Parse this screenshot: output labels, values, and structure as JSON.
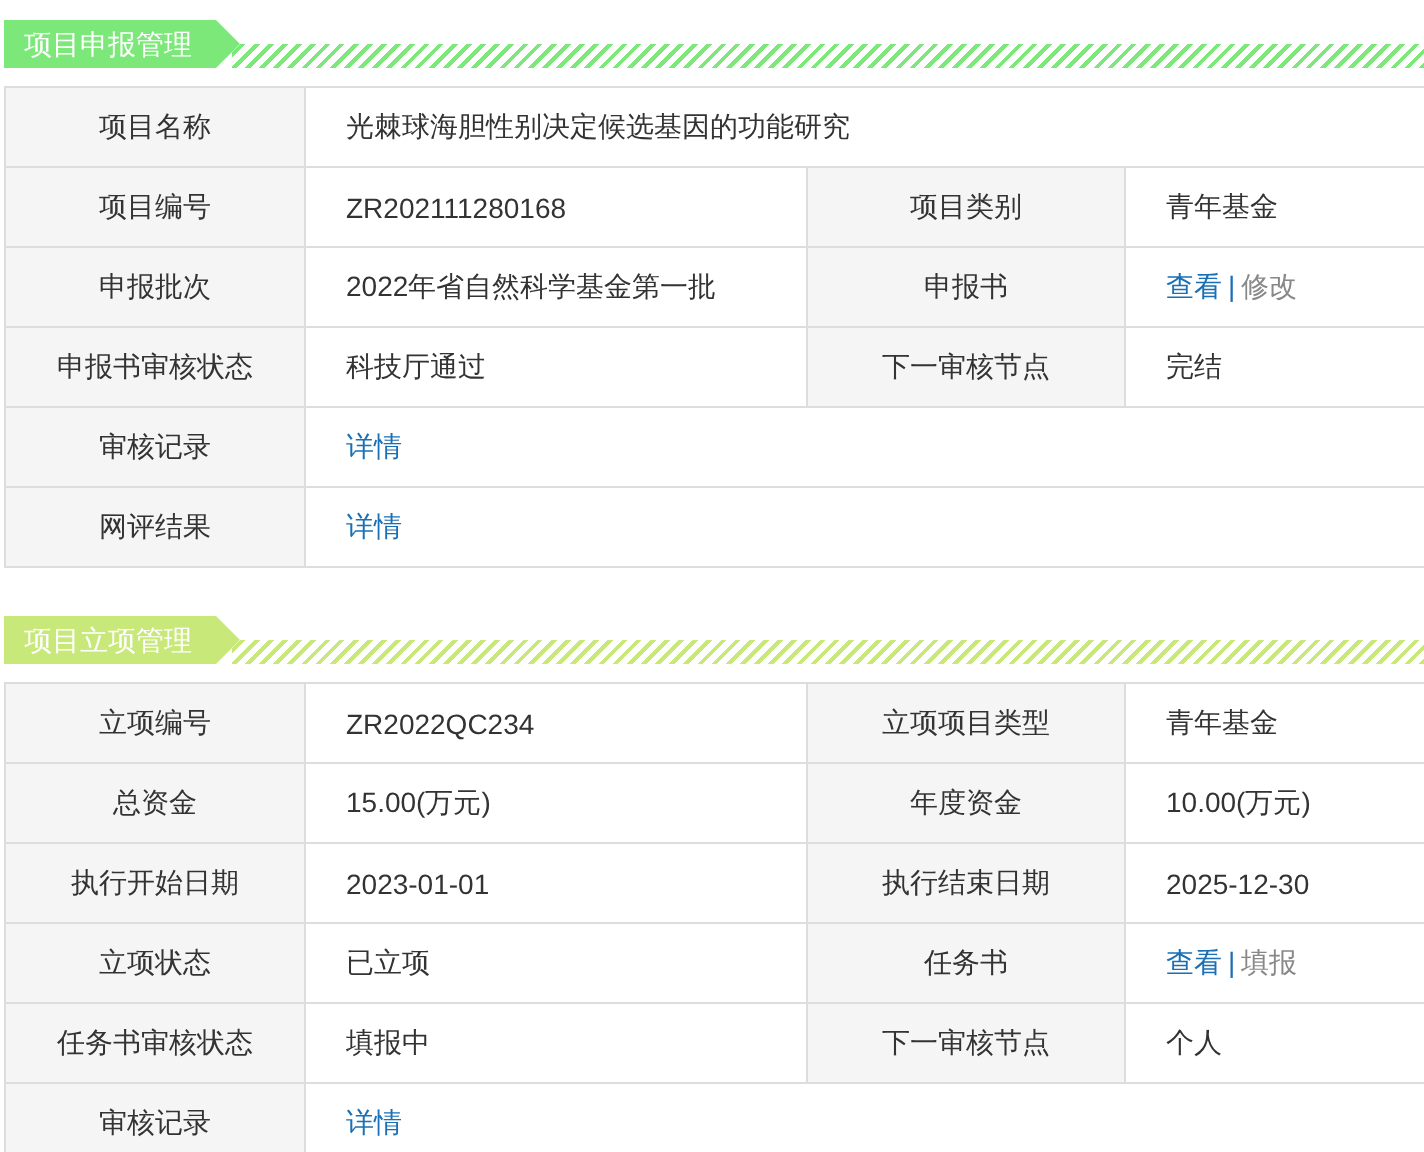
{
  "sections": [
    {
      "title": "项目申报管理",
      "color": "#7de87a",
      "rows": [
        {
          "cells": [
            {
              "kind": "label",
              "text": "项目名称"
            },
            {
              "kind": "text",
              "text": "光棘球海胆性别决定候选基因的功能研究",
              "colspan": 3
            }
          ]
        },
        {
          "cells": [
            {
              "kind": "label",
              "text": "项目编号"
            },
            {
              "kind": "text",
              "text": "ZR202111280168"
            },
            {
              "kind": "label",
              "text": "项目类别"
            },
            {
              "kind": "text",
              "text": "青年基金"
            }
          ]
        },
        {
          "cells": [
            {
              "kind": "label",
              "text": "申报批次"
            },
            {
              "kind": "text",
              "text": "2022年省自然科学基金第一批"
            },
            {
              "kind": "label",
              "text": "申报书"
            },
            {
              "kind": "links",
              "separator": "|",
              "links": [
                {
                  "text": "查看",
                  "disabled": false
                },
                {
                  "text": "修改",
                  "disabled": true
                }
              ]
            }
          ]
        },
        {
          "cells": [
            {
              "kind": "label",
              "text": "申报书审核状态"
            },
            {
              "kind": "text",
              "text": "科技厅通过"
            },
            {
              "kind": "label",
              "text": "下一审核节点"
            },
            {
              "kind": "text",
              "text": "完结"
            }
          ]
        },
        {
          "cells": [
            {
              "kind": "label",
              "text": "审核记录"
            },
            {
              "kind": "links",
              "colspan": 3,
              "links": [
                {
                  "text": "详情",
                  "disabled": false
                }
              ]
            }
          ]
        },
        {
          "cells": [
            {
              "kind": "label",
              "text": "网评结果"
            },
            {
              "kind": "links",
              "colspan": 3,
              "links": [
                {
                  "text": "详情",
                  "disabled": false
                }
              ]
            }
          ]
        }
      ]
    },
    {
      "title": "项目立项管理",
      "color": "#c8e87a",
      "rows": [
        {
          "cells": [
            {
              "kind": "label",
              "text": "立项编号"
            },
            {
              "kind": "text",
              "text": "ZR2022QC234"
            },
            {
              "kind": "label",
              "text": "立项项目类型"
            },
            {
              "kind": "text",
              "text": "青年基金"
            }
          ]
        },
        {
          "cells": [
            {
              "kind": "label",
              "text": "总资金"
            },
            {
              "kind": "text",
              "text": "15.00(万元)"
            },
            {
              "kind": "label",
              "text": "年度资金"
            },
            {
              "kind": "text",
              "text": "10.00(万元)"
            }
          ]
        },
        {
          "cells": [
            {
              "kind": "label",
              "text": "执行开始日期"
            },
            {
              "kind": "text",
              "text": "2023-01-01"
            },
            {
              "kind": "label",
              "text": "执行结束日期"
            },
            {
              "kind": "text",
              "text": "2025-12-30"
            }
          ]
        },
        {
          "cells": [
            {
              "kind": "label",
              "text": "立项状态"
            },
            {
              "kind": "text",
              "text": "已立项"
            },
            {
              "kind": "label",
              "text": "任务书"
            },
            {
              "kind": "links",
              "separator": "|",
              "links": [
                {
                  "text": "查看",
                  "disabled": false
                },
                {
                  "text": "填报",
                  "disabled": true
                }
              ]
            }
          ]
        },
        {
          "cells": [
            {
              "kind": "label",
              "text": "任务书审核状态"
            },
            {
              "kind": "text",
              "text": "填报中"
            },
            {
              "kind": "label",
              "text": "下一审核节点"
            },
            {
              "kind": "text",
              "text": "个人"
            }
          ]
        },
        {
          "cells": [
            {
              "kind": "label",
              "text": "审核记录"
            },
            {
              "kind": "links",
              "colspan": 3,
              "links": [
                {
                  "text": "详情",
                  "disabled": false
                }
              ]
            }
          ]
        }
      ]
    }
  ]
}
